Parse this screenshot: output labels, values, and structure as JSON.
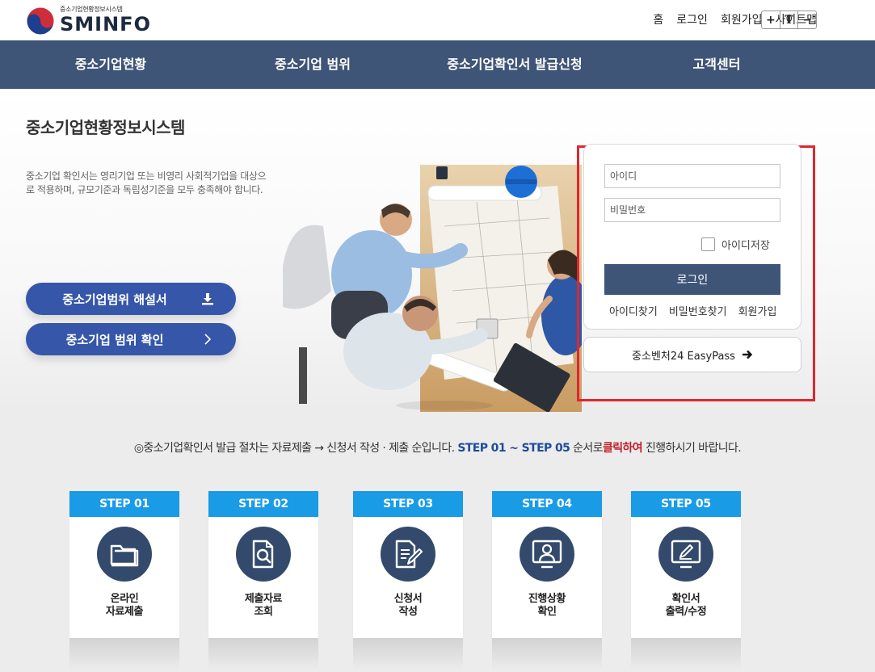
{
  "header": {
    "logo_small": "중소기업현황정보시스템",
    "logo_big": "SMINFO",
    "util_links": [
      "홈",
      "로그인",
      "회원가입",
      "사이트맵"
    ],
    "font_controls": [
      "+",
      "T",
      "−"
    ]
  },
  "nav": {
    "items": [
      "중소기업현황",
      "중소기업 범위",
      "중소기업확인서 발급신청",
      "고객센터"
    ],
    "bg_color": "#3e5577"
  },
  "hero": {
    "title": "중소기업현황정보시스템",
    "description": "중소기업 확인서는 영리기업 또는 비영리 사회적기업을 대상으로 적용하며, 규모기준과 독립성기준을 모두 충족해야 합니다.",
    "button_guide": "중소기업범위 해설서",
    "button_check": "중소기업 범위 확인",
    "button_color": "#3656a9"
  },
  "login": {
    "id_placeholder": "아이디",
    "pw_placeholder": "비밀번호",
    "remember_label": "아이디저장",
    "login_button": "로그인",
    "links": [
      "아이디찾기",
      "비밀번호찾기",
      "회원가입"
    ],
    "easypass_label": "중소벤처24 EasyPass",
    "highlight_color": "#e0262e"
  },
  "notice": {
    "part1": "◎중소기업확인서 발급 절차는 자료제출 → 신청서 작성 · 제출 순입니다.",
    "step_range": "STEP 01 ~ STEP 05",
    "part2": "순서로",
    "emphasis": "클릭하여",
    "part3": "진행하시기 바랍니다."
  },
  "steps": [
    {
      "header": "STEP 01",
      "line1": "온라인",
      "line2": "자료제출",
      "icon": "folder-icon"
    },
    {
      "header": "STEP 02",
      "line1": "제출자료",
      "line2": "조회",
      "icon": "document-search-icon"
    },
    {
      "header": "STEP 03",
      "line1": "신청서",
      "line2": "작성",
      "icon": "document-edit-icon"
    },
    {
      "header": "STEP 04",
      "line1": "진행상황",
      "line2": "확인",
      "icon": "monitor-user-icon"
    },
    {
      "header": "STEP 05",
      "line1": "확인서",
      "line2": "출력/수정",
      "icon": "monitor-pen-icon"
    }
  ],
  "colors": {
    "step_header": "#1a9be6",
    "step_circle": "#344a6c"
  }
}
